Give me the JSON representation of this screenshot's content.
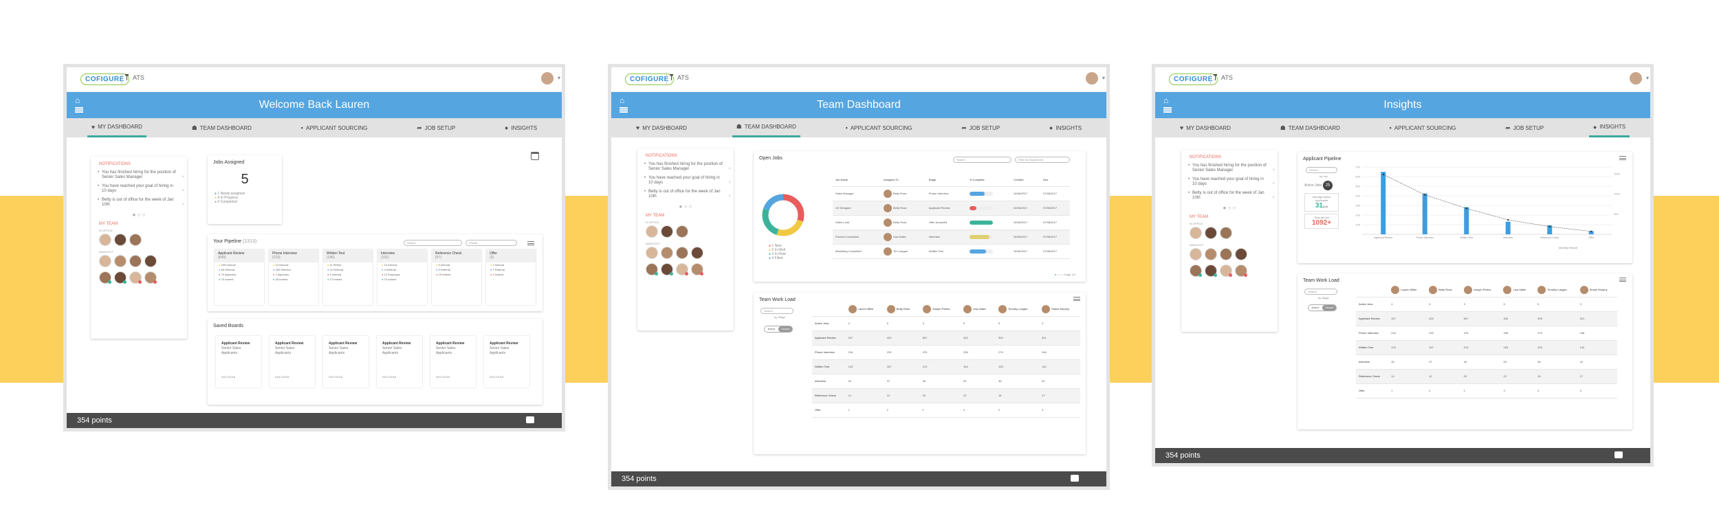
{
  "common": {
    "logo": "COFIGURE",
    "app_name": "ATS",
    "nav": [
      {
        "label": "MY DASHBOARD",
        "icon": "heart-icon"
      },
      {
        "label": "TEAM DASHBOARD",
        "icon": "team-icon"
      },
      {
        "label": "APPLICANT SOURCING",
        "icon": "folder-icon"
      },
      {
        "label": "JOB SETUP",
        "icon": "share-icon"
      },
      {
        "label": "INSIGHTS",
        "icon": "lightbulb-icon"
      }
    ],
    "points": "354 points",
    "notifications": {
      "title": "NOTIFICATIONS",
      "items": [
        "You has finished hiring for the position of Senior Sales Manager",
        "You have reached your goal of hiring in 10 days",
        "Betty is out of office for the week of Jan 10th"
      ]
    },
    "team": {
      "title": "MY TEAM",
      "in_office": "IN OFFICE",
      "away": "AWAY/OUT"
    },
    "colors": {
      "banner": "#55a5e0",
      "nav_active": "#3aa99f",
      "accent_band": "#fdd05c",
      "footer": "#4b4b4b"
    }
  },
  "screen1": {
    "title": "Welcome Back Lauren",
    "jobs_assigned": {
      "title": "Jobs Assigned",
      "count": "5",
      "legend": [
        "1 Newly assigned",
        "4 In Progress",
        "0 Completed"
      ]
    },
    "pipeline": {
      "title": "Your Pipeline",
      "count": "(1313)",
      "search": "Search",
      "filter": "Private",
      "stages": [
        {
          "name": "Applicant Review",
          "count": "(649)",
          "rows": [
            "209 Internal",
            "65 Referral",
            "79 Agencies",
            "75 Indeed"
          ]
        },
        {
          "name": "Phone Interview",
          "count": "(210)",
          "rows": [
            "10 Internal",
            "259 Referral",
            "7 Agencies",
            "28 Indeed"
          ]
        },
        {
          "name": "Written Test",
          "count": "(140)",
          "rows": [
            "11 Rehire",
            "12 Referral",
            "9 Internal",
            "72 Indeed"
          ]
        },
        {
          "name": "Interview",
          "count": "(131)",
          "rows": [
            "15 Internal",
            "3 Referral",
            "13 Employee",
            "75 Indeed"
          ]
        },
        {
          "name": "Reference Check",
          "count": "(57)",
          "rows": [
            "9 Internal",
            "9 Referral",
            "15 Indeed"
          ]
        },
        {
          "name": "Offer",
          "count": "(3)",
          "rows": [
            "2 Internal",
            "7 Referral",
            "4 Indeed"
          ]
        }
      ]
    },
    "saved_boards": {
      "title": "Saved Boards",
      "items": [
        {
          "name": "Applicant Review",
          "sub": "Senior Sales Applicants",
          "date": "03/17/2018"
        },
        {
          "name": "Applicant Review",
          "sub": "Senior Sales Applicants",
          "date": "03/17/2018"
        },
        {
          "name": "Applicant Review",
          "sub": "Senior Sales Applicants",
          "date": "03/17/2018"
        },
        {
          "name": "Applicant Review",
          "sub": "Senior Sales Applicants",
          "date": "03/17/2018"
        },
        {
          "name": "Applicant Review",
          "sub": "Senior Sales Applicants",
          "date": "03/17/2018"
        },
        {
          "name": "Applicant Review",
          "sub": "Senior Sales Applicants",
          "date": "03/17/2018"
        }
      ]
    }
  },
  "screen2": {
    "title": "Team Dashboard",
    "open_jobs": {
      "title": "Open Jobs",
      "search": "Search",
      "filter": "Filter by Department",
      "legend": [
        "1 New",
        "2 In-Well",
        "3 In-Hold",
        "4 Filled"
      ],
      "donut": [
        {
          "label": "1 New",
          "value": 30,
          "color": "#e85c5c"
        },
        {
          "label": "2 In-Well",
          "value": 25,
          "color": "#f0c843"
        },
        {
          "label": "3 In-Hold",
          "value": 25,
          "color": "#3bb39a"
        },
        {
          "label": "4 Filled",
          "value": 20,
          "color": "#55a5e0"
        }
      ],
      "headers": [
        "Job Name",
        "Assigned To",
        "Stage",
        "% Complete",
        "Created",
        "Due"
      ],
      "rows": [
        {
          "job": "Sales Manager",
          "to": "Betty Rose",
          "stage": "Phone Interview",
          "pct": 0.65,
          "color": "#55a5e0",
          "created": "04/06/2017",
          "due": "07/06/2017"
        },
        {
          "job": "UX Designer",
          "to": "Betty Rose",
          "stage": "Applicant Review",
          "pct": 0.3,
          "color": "#e85c5c",
          "created": "04/06/2017",
          "due": "07/06/2017"
        },
        {
          "job": "Sales Lead",
          "to": "Betty Rose",
          "stage": "Offer Accepted",
          "pct": 1,
          "color": "#3bb39a",
          "created": "04/06/2017",
          "due": "07/06/2017"
        },
        {
          "job": "Product Consultant",
          "to": "Lisa Haller",
          "stage": "Interview",
          "pct": 0.85,
          "color": "#e0d070",
          "created": "04/06/2017",
          "due": "07/06/2017"
        },
        {
          "job": "Marketing Consultant",
          "to": "Tim Langan",
          "stage": "Written Test",
          "pct": 0.7,
          "color": "#55a5e0",
          "created": "04/06/2017",
          "due": "07/06/2017"
        }
      ],
      "pager": "Page 1/3"
    },
    "workload": {
      "title": "Team Work Load",
      "search": "Search",
      "view": "by Stage",
      "toggle": [
        "Active",
        "Closed"
      ],
      "people": [
        "Lauren Miller",
        "Betty Rose",
        "Joseph Peters",
        "Lisa Haller",
        "Timothy Langan",
        "Shane Murphy"
      ],
      "rows": [
        {
          "label": "Active Jobs",
          "v": [
            "4",
            "5",
            "3",
            "5",
            "5",
            "3"
          ]
        },
        {
          "label": "Applicant Review",
          "v": [
            "347",
            "420",
            "567",
            "343",
            "309",
            "321"
          ]
        },
        {
          "label": "Phone Interview",
          "v": [
            "234",
            "230",
            "376",
            "336",
            "275",
            "248"
          ]
        },
        {
          "label": "Written Test",
          "v": [
            "123",
            "167",
            "213",
            "163",
            "153",
            "142"
          ]
        },
        {
          "label": "Interview",
          "v": [
            "30",
            "37",
            "46",
            "53",
            "36",
            "42"
          ]
        },
        {
          "label": "Reference Check",
          "v": [
            "14",
            "12",
            "20",
            "22",
            "16",
            "17"
          ]
        },
        {
          "label": "Offer",
          "v": [
            "1",
            "2",
            "1",
            "3",
            "2",
            "3"
          ]
        }
      ]
    }
  },
  "screen3": {
    "title": "Insights",
    "pipeline": {
      "title": "Applicant Pipeline",
      "search": "Search",
      "view": "by Job",
      "active": "Active Jobs",
      "active_count": "25",
      "avg_label": "Average Active Applicants",
      "avg": "31",
      "avg_unit": "/job",
      "total_label": "Total per job",
      "total": "1092+",
      "chart_link": "Monthly Report"
    },
    "workload": {
      "title": "Team Work Load",
      "search": "Search",
      "view": "by Stage",
      "toggle": [
        "Active",
        "Closed"
      ],
      "people": [
        "Lauren Miller",
        "Betty Rose",
        "Joseph Peters",
        "Lisa Haller",
        "Timothy Langan",
        "Shane Murphy"
      ],
      "rows": [
        {
          "label": "Active Jobs",
          "v": [
            "4",
            "5",
            "3",
            "5",
            "5",
            "3"
          ]
        },
        {
          "label": "Applicant Review",
          "v": [
            "347",
            "420",
            "567",
            "343",
            "309",
            "321"
          ]
        },
        {
          "label": "Phone Interview",
          "v": [
            "234",
            "230",
            "376",
            "336",
            "275",
            "248"
          ]
        },
        {
          "label": "Written Test",
          "v": [
            "123",
            "167",
            "213",
            "163",
            "153",
            "142"
          ]
        },
        {
          "label": "Interview",
          "v": [
            "30",
            "37",
            "46",
            "53",
            "36",
            "42"
          ]
        },
        {
          "label": "Reference Check",
          "v": [
            "14",
            "12",
            "20",
            "22",
            "16",
            "17"
          ]
        },
        {
          "label": "Offer",
          "v": [
            "1",
            "2",
            "1",
            "3",
            "2",
            "3"
          ]
        }
      ]
    }
  },
  "chart_data": {
    "type": "bar",
    "categories": [
      "Applicant Review",
      "Phone Interview",
      "Written Test",
      "Interview",
      "Reference Check",
      "Offer"
    ],
    "series": [
      {
        "values": [
          649,
          424,
          282,
          131,
          93,
          33
        ]
      },
      {
        "values": [
          622,
          410,
          270,
          150,
          80,
          30
        ]
      }
    ],
    "ylim": [
      0,
      700
    ],
    "y_ticks": [
      "100",
      "200",
      "300",
      "400",
      "500",
      "600",
      "700"
    ],
    "y2_ticks": [
      "500",
      "1000",
      "1500"
    ],
    "grid": true
  }
}
